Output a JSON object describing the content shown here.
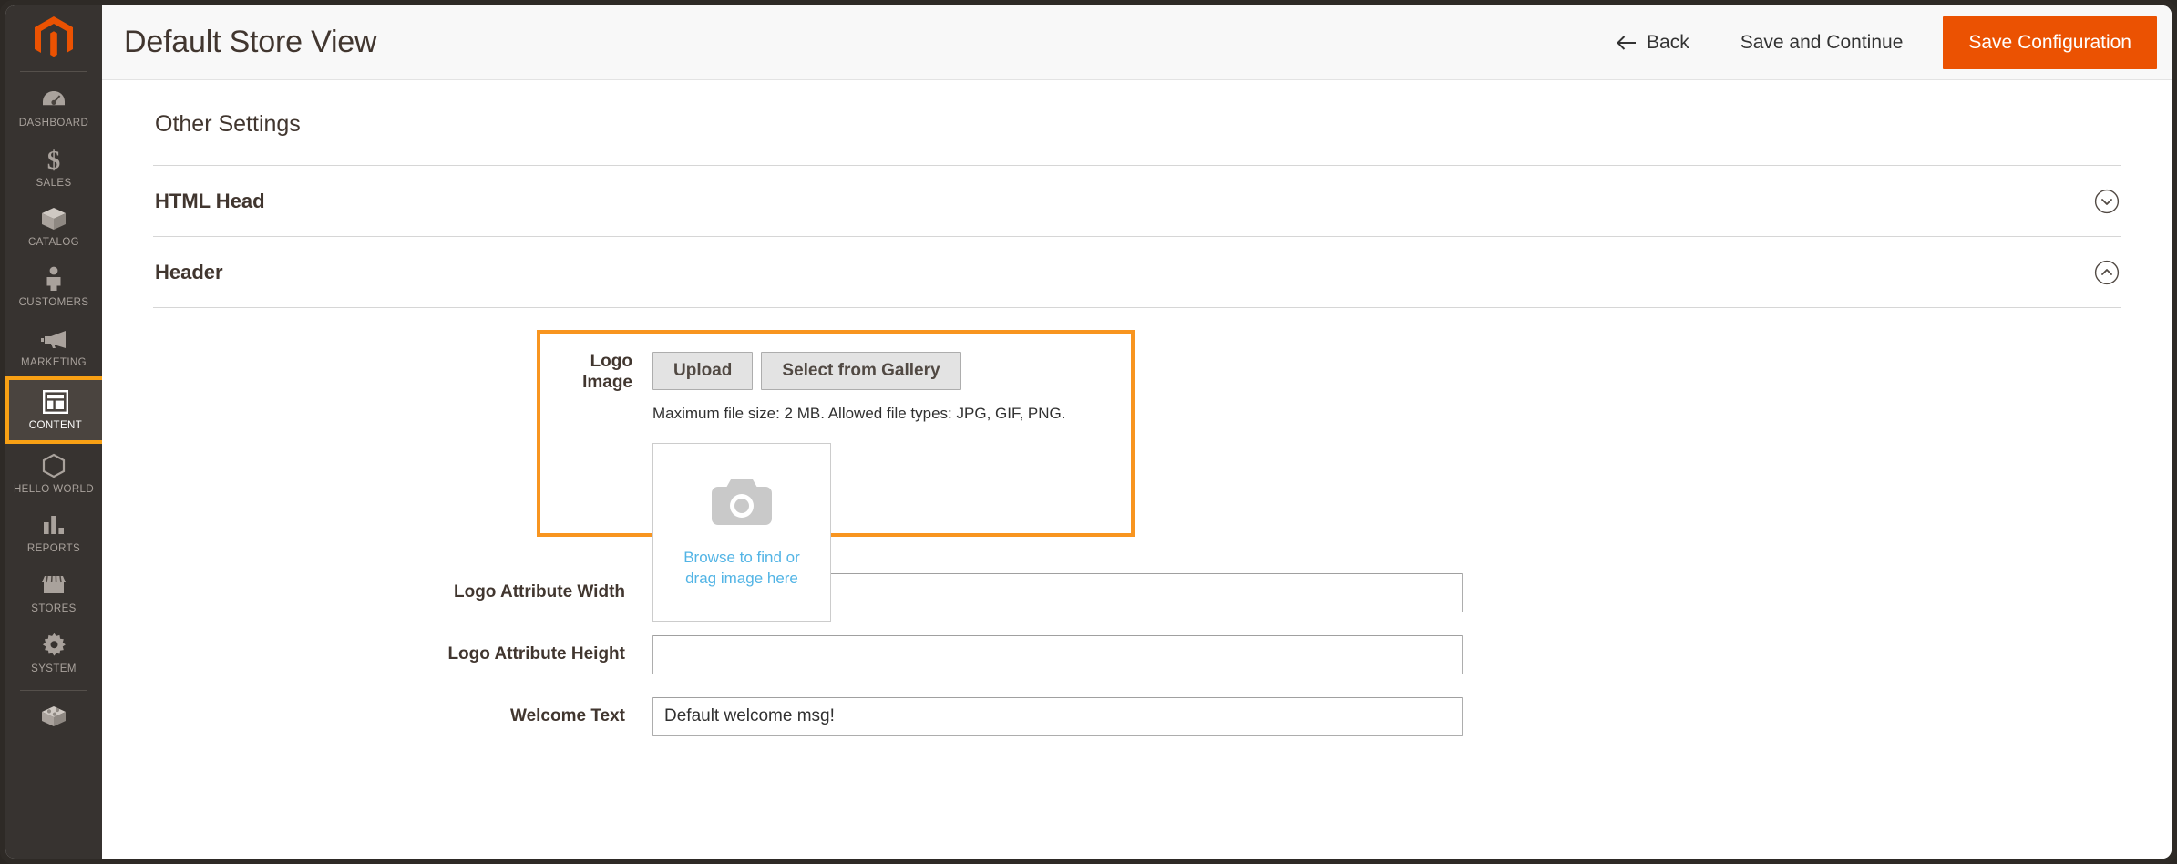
{
  "theme": {
    "brand_orange": "#eb5202",
    "highlight_orange": "#f89520",
    "sidebar_bg": "#373330",
    "link_blue": "#52b4e5"
  },
  "sidebar": {
    "logo_name": "magento-logo",
    "items": [
      {
        "label": "DASHBOARD",
        "icon": "dashboard-icon",
        "active": false
      },
      {
        "label": "SALES",
        "icon": "dollar-icon",
        "active": false
      },
      {
        "label": "CATALOG",
        "icon": "box-icon",
        "active": false
      },
      {
        "label": "CUSTOMERS",
        "icon": "person-icon",
        "active": false
      },
      {
        "label": "MARKETING",
        "icon": "megaphone-icon",
        "active": false
      },
      {
        "label": "CONTENT",
        "icon": "layout-icon",
        "active": true
      },
      {
        "label": "HELLO WORLD",
        "icon": "hexagon-icon",
        "active": false
      },
      {
        "label": "REPORTS",
        "icon": "bar-chart-icon",
        "active": false
      },
      {
        "label": "STORES",
        "icon": "storefront-icon",
        "active": false
      },
      {
        "label": "SYSTEM",
        "icon": "gear-icon",
        "active": false
      },
      {
        "label": "",
        "icon": "extensions-icon",
        "active": false
      }
    ]
  },
  "header": {
    "title": "Default Store View",
    "back_label": "Back",
    "save_continue_label": "Save and Continue",
    "save_config_label": "Save Configuration"
  },
  "main": {
    "section_title": "Other Settings",
    "accordions": [
      {
        "title": "HTML Head",
        "state": "collapsed",
        "toggle_icon": "chevron-down-circle-icon"
      },
      {
        "title": "Header",
        "state": "expanded",
        "toggle_icon": "chevron-up-circle-icon"
      }
    ],
    "logo_image_field": {
      "label": "Logo Image",
      "upload_label": "Upload",
      "gallery_label": "Select from Gallery",
      "note": "Maximum file size: 2 MB. Allowed file types: JPG, GIF, PNG.",
      "dropzone_line1": "Browse to find or",
      "dropzone_line2": "drag image here",
      "dropzone_icon": "camera-icon",
      "highlighted": true
    },
    "fields": [
      {
        "label": "Logo Attribute Width",
        "value": "",
        "placeholder": ""
      },
      {
        "label": "Logo Attribute Height",
        "value": "",
        "placeholder": ""
      },
      {
        "label": "Welcome Text",
        "value": "Default welcome msg!",
        "placeholder": ""
      }
    ]
  }
}
